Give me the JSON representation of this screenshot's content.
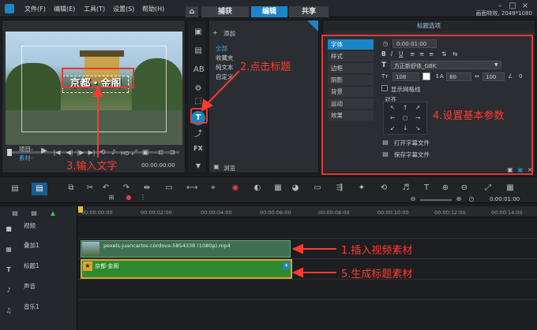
{
  "menu": {
    "file": "文件(F)",
    "edit": "编辑(E)",
    "tools": "工具(T)",
    "settings": "设置(S)",
    "help": "帮助(H)"
  },
  "tabs": {
    "capture": "捕获",
    "edit": "编辑",
    "share": "共享"
  },
  "project_info": "画面特效, 2048*1080",
  "preview": {
    "title_text": "京都・金阁",
    "project_label": "项目-",
    "clip_label": "素材-",
    "timecode": "00:00:00:00"
  },
  "library": {
    "add": "添加",
    "items": [
      "全部",
      "收藏夹",
      "纯文本",
      "自定义"
    ],
    "browse": "浏览"
  },
  "options": {
    "title": "标题选项",
    "tabs": [
      "字体",
      "样式",
      "边框",
      "阴影",
      "背景",
      "运动",
      "效果"
    ],
    "timecode": "0:00:01:00",
    "font_name": "方正新舒体_GBK",
    "font_size": "108",
    "line_spacing": "80",
    "tracking": "100",
    "angle": "0",
    "grid_label": "显示网格线",
    "align_label": "对齐",
    "open_title_file": "打开字幕文件",
    "save_title_file": "保存字幕文件"
  },
  "timeline": {
    "ticks": [
      "00:00:00:00",
      "00:00:02:00",
      "00:00:04:00",
      "00:00:06:00",
      "00:00:08:00",
      "00:00:10:00",
      "00:00:12:00",
      "00:00:14:00"
    ],
    "total_time": "0:00:01:00",
    "tracks": [
      "视频",
      "叠加1",
      "标题1",
      "声音",
      "音乐1"
    ],
    "video_clip": "pexels-juancarlos-córdova-5854338 (1080p).mp4",
    "title_clip": "京都·金阁"
  },
  "annotations": {
    "step1": "1.插入视频素材",
    "step2": "2.点击标题",
    "step3": "3.输入文字",
    "step4": "4.设置基本参数",
    "step5": "5.生成标题素材"
  },
  "colors": {
    "accent": "#1a86c7",
    "annotation": "#ff3b30",
    "video_clip": "#3f6f52",
    "title_clip": "#2f8a2f"
  }
}
